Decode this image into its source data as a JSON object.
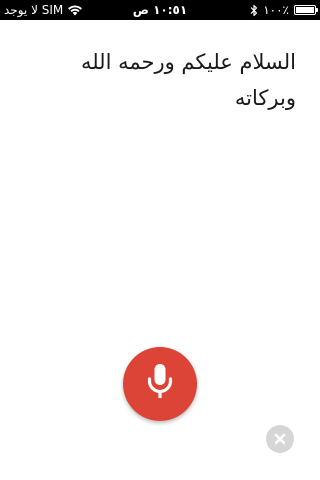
{
  "status_bar": {
    "carrier": "لا يوجد SIM",
    "time": "١٠:٥١ ص",
    "battery_text": "١٠٠٪",
    "battery_level": 1.0,
    "wifi_icon": "wifi-icon",
    "bluetooth_icon": "bluetooth-icon"
  },
  "transcript": {
    "text": "السلام عليكم ورحمه الله وبركاته"
  },
  "mic": {
    "icon": "microphone-icon",
    "color": "#db4437"
  },
  "close": {
    "icon": "close-icon",
    "color": "#d6d6d6"
  }
}
